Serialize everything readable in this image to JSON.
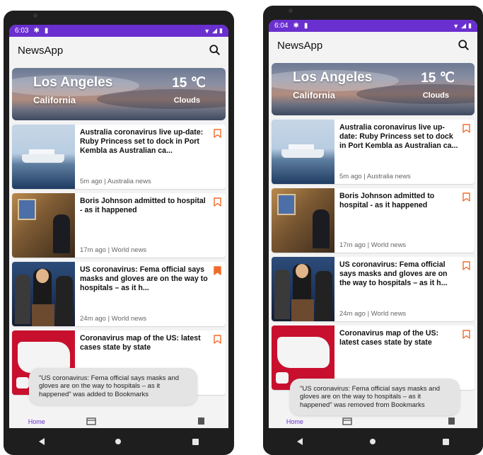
{
  "screens": [
    {
      "status": {
        "time": "6:03"
      },
      "app_title": "NewsApp",
      "weather": {
        "city": "Los Angeles",
        "state": "California",
        "temp": "15 ℃",
        "condition": "Clouds"
      },
      "articles": [
        {
          "title": "Australia coronavirus live up-date: Ruby Princess set to dock in Port Kembla as Australian ca...",
          "time": "5m ago",
          "section": "Australia news",
          "bookmarked": false
        },
        {
          "title": "Boris Johnson admitted to hospital - as it happened",
          "time": "17m ago",
          "section": "World news",
          "bookmarked": false
        },
        {
          "title": "US coronavirus: Fema official says masks and gloves are on the way to hospitals – as it h...",
          "time": "24m ago",
          "section": "World news",
          "bookmarked": true
        },
        {
          "title": "Coronavirus map of the US: latest cases state by state",
          "time": "",
          "section": "",
          "bookmarked": false
        }
      ],
      "toast": "\"US coronavirus: Fema official says masks and gloves are on the way to hospitals – as it happened\" was added to Bookmarks",
      "nav": {
        "home_label": "Home"
      },
      "accent": "#6a2fcf",
      "bookmark_color": "#f26a2a"
    },
    {
      "status": {
        "time": "6:04"
      },
      "app_title": "NewsApp",
      "weather": {
        "city": "Los Angeles",
        "state": "California",
        "temp": "15 ℃",
        "condition": "Clouds"
      },
      "articles": [
        {
          "title": "Australia coronavirus live up-date: Ruby Princess set to dock in Port Kembla as Australian ca...",
          "time": "5m ago",
          "section": "Australia news",
          "bookmarked": false
        },
        {
          "title": "Boris Johnson admitted to hospital - as it happened",
          "time": "17m ago",
          "section": "World news",
          "bookmarked": false
        },
        {
          "title": "US coronavirus: Fema official says masks and gloves are on the way to hospitals – as it h...",
          "time": "24m ago",
          "section": "World news",
          "bookmarked": false
        },
        {
          "title": "Coronavirus map of the US: latest cases state by state",
          "time": "",
          "section": "",
          "bookmarked": false
        }
      ],
      "toast": "\"US coronavirus: Fema official says masks and gloves are on the way to hospitals – as it happened\" was removed from Bookmarks",
      "nav": {
        "home_label": "Home"
      },
      "accent": "#6a2fcf",
      "bookmark_color": "#f26a2a"
    }
  ]
}
